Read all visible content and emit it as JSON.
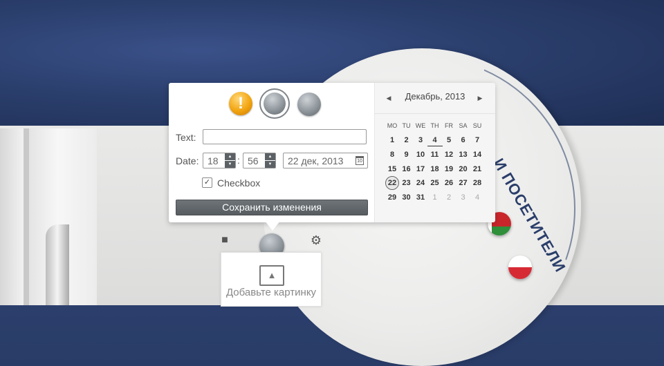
{
  "background": {
    "arc_text": "И ПОСЕТИТЕЛИ",
    "under_card_text": "Добавьте картинку"
  },
  "popover": {
    "status_icons": [
      "warning-icon",
      "grey-orb-icon",
      "grey-orb-icon"
    ],
    "text_label": "Text:",
    "text_value": "",
    "date_label": "Date:",
    "hour_value": "18",
    "minute_value": "56",
    "time_separator": ":",
    "date_value": "22 дек, 2013",
    "checkbox_label": "Checkbox",
    "checkbox_checked": true,
    "save_label": "Сохранить изменения"
  },
  "calendar": {
    "title": "Декабрь, 2013",
    "weekdays": [
      "MO",
      "TU",
      "WE",
      "TH",
      "FR",
      "SA",
      "SU"
    ],
    "weeks": [
      [
        "1",
        "2",
        "3",
        "4",
        "5",
        "6",
        "7"
      ],
      [
        "8",
        "9",
        "10",
        "11",
        "12",
        "13",
        "14"
      ],
      [
        "15",
        "16",
        "17",
        "18",
        "19",
        "20",
        "21"
      ],
      [
        "22",
        "23",
        "24",
        "25",
        "26",
        "27",
        "28"
      ],
      [
        "29",
        "30",
        "31",
        "1",
        "2",
        "3",
        "4"
      ]
    ],
    "selected_day": "22",
    "today_day": "4",
    "next_month_days_start": 3
  },
  "colors": {
    "accent_button": "#5c6165",
    "warning": "#f2a511",
    "bg_blue": "#2c3f6c"
  }
}
